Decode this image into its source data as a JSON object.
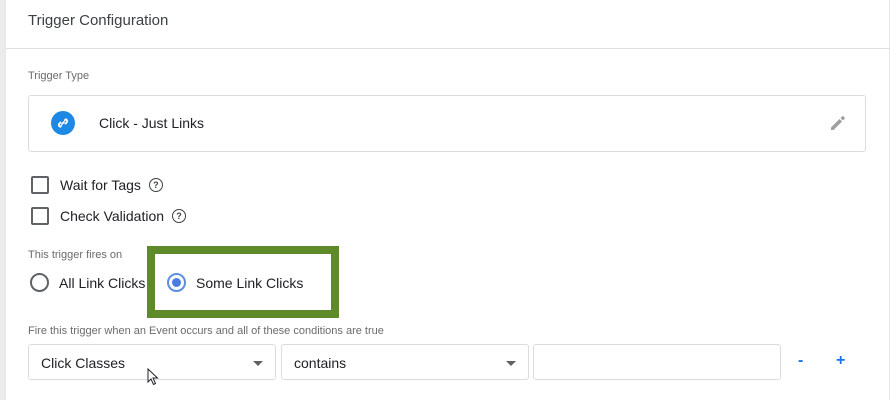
{
  "header": {
    "title": "Trigger Configuration"
  },
  "trigger_type": {
    "section_label": "Trigger Type",
    "name": "Click - Just Links",
    "icon": "link-icon",
    "icon_color": "#1e88e5"
  },
  "options": [
    {
      "label": "Wait for Tags",
      "checked": false
    },
    {
      "label": "Check Validation",
      "checked": false
    }
  ],
  "fires_on": {
    "label": "This trigger fires on",
    "options": [
      {
        "label": "All Link Clicks",
        "selected": false
      },
      {
        "label": "Some Link Clicks",
        "selected": true
      }
    ],
    "highlight_color": "#5f8a2a"
  },
  "conditions": {
    "label": "Fire this trigger when an Event occurs and all of these conditions are true",
    "variable": "Click Classes",
    "operator": "contains",
    "value": "",
    "remove_label": "-",
    "add_label": "+"
  }
}
